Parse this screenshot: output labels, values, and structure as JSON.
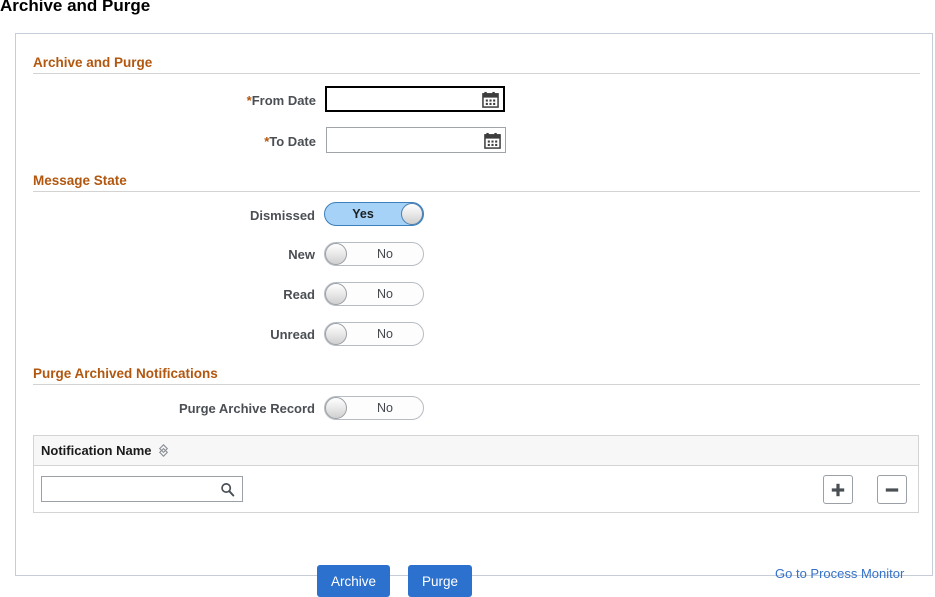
{
  "page": {
    "title": "Archive and Purge"
  },
  "panel": {
    "sections": [
      {
        "id": "archive_and_purge",
        "heading": "Archive and Purge",
        "fields": [
          {
            "label": "From Date",
            "required_marker": "*",
            "value": "",
            "placeholder": "",
            "icon": "calendar-icon",
            "focused": true
          },
          {
            "label": "To Date",
            "required_marker": "*",
            "value": "",
            "placeholder": "",
            "icon": "calendar-icon",
            "focused": false
          }
        ]
      },
      {
        "id": "message_state",
        "heading": "Message State",
        "toggles": [
          {
            "label": "Dismissed",
            "state": "Yes",
            "on": true
          },
          {
            "label": "New",
            "state": "No",
            "on": false
          },
          {
            "label": "Read",
            "state": "No",
            "on": false
          },
          {
            "label": "Unread",
            "state": "No",
            "on": false
          }
        ]
      },
      {
        "id": "purge_archived_notifications",
        "heading": "Purge Archived Notifications",
        "toggles": [
          {
            "label": "Purge Archive Record",
            "state": "No",
            "on": false
          }
        ]
      }
    ],
    "grid": {
      "column_header": "Notification Name",
      "sort_icon": "sort-updown-icon",
      "search": {
        "value": "",
        "placeholder": "",
        "icon": "search-icon"
      },
      "add_row_label": "+",
      "delete_row_label": "−"
    },
    "actions": {
      "archive_label": "Archive",
      "purge_label": "Purge",
      "process_monitor_link": "Go to Process Monitor"
    }
  },
  "colors": {
    "section_heading": "#b2570f",
    "primary_button": "#2b71cd",
    "link": "#3572c8",
    "toggle_on_fill": "#a5d2f6",
    "panel_border": "#c6ccd8"
  }
}
